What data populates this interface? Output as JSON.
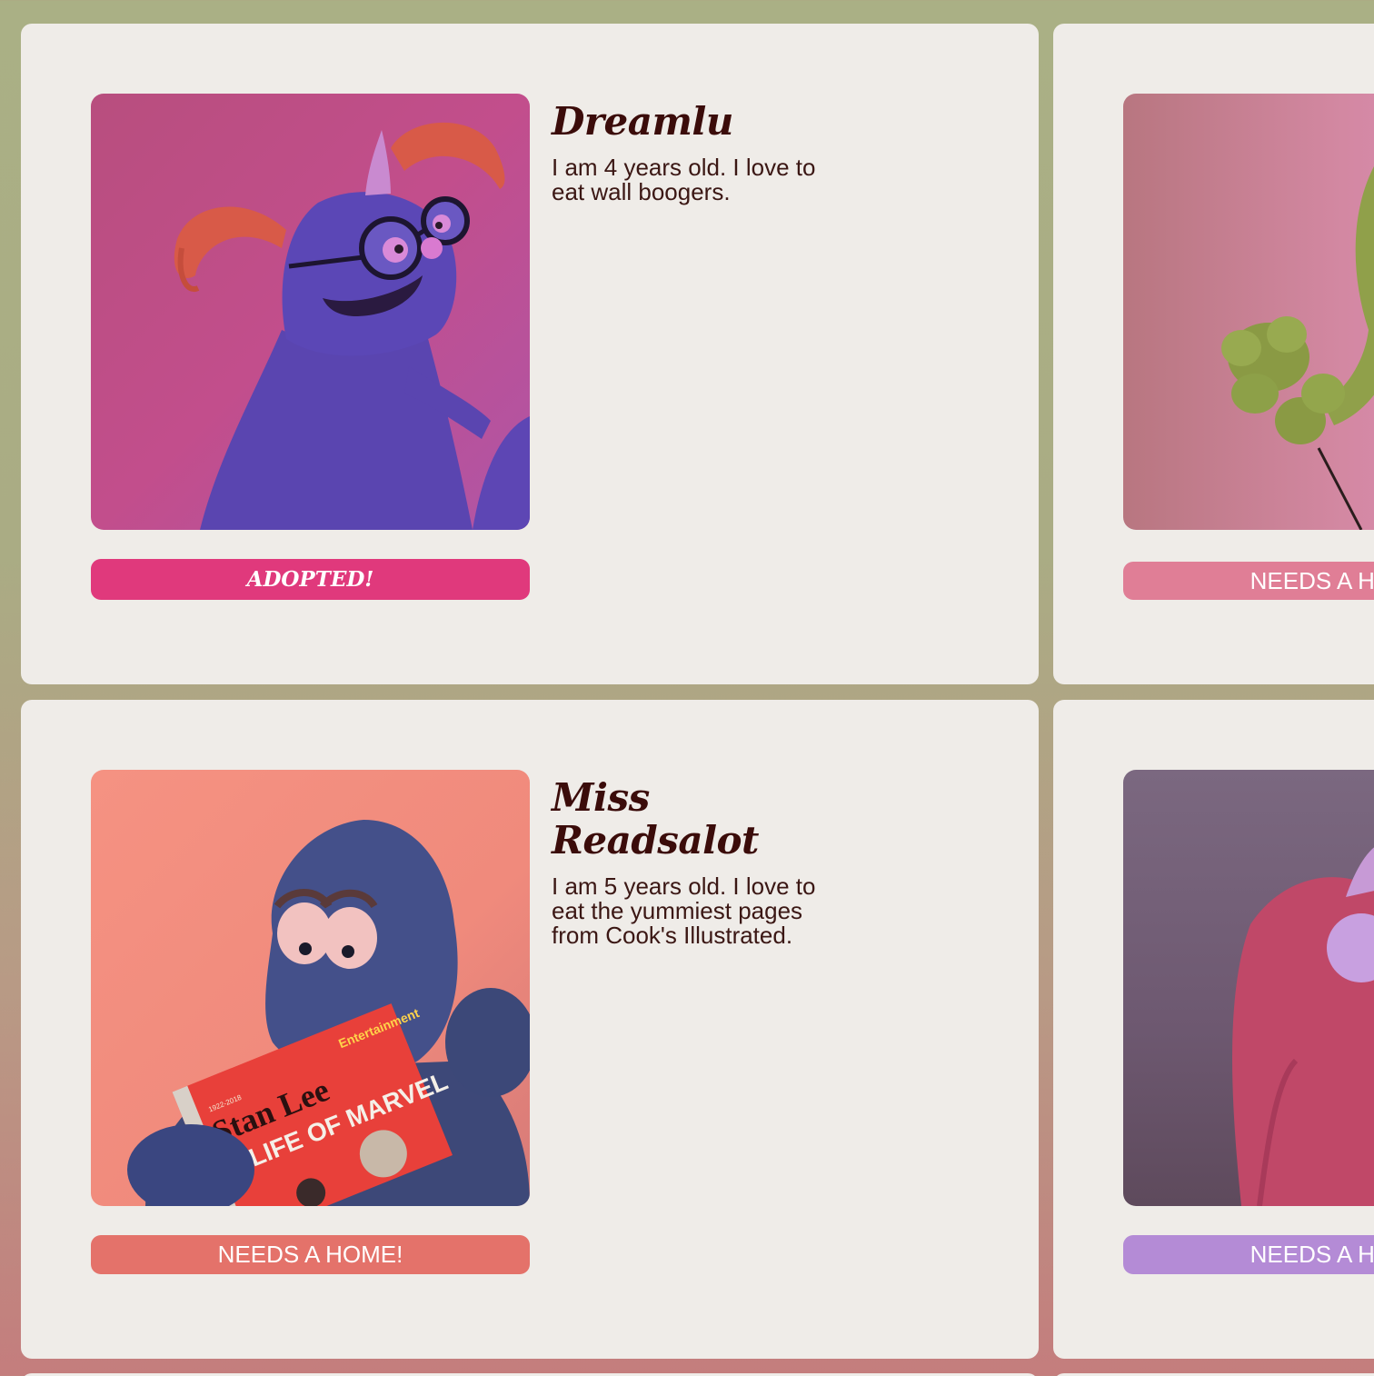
{
  "colors": {
    "card_bg": "#efece8",
    "name_text": "#3b0c0a",
    "adopted_badge": "#e0397c",
    "coral_badge": "#e4726a",
    "pink_badge": "#e07e96",
    "lilac_badge": "#b48bd6"
  },
  "puppets": [
    {
      "name": "Dreamlu",
      "description": "I am 4 years old. I love to eat wall boogers.",
      "status": "ADOPTED!",
      "photo_subject": "blue furry monster with glasses and orange pigtails"
    },
    {
      "name": "",
      "description": "",
      "status": "NEEDS A HOME!",
      "photo_subject": "green furry monster hand with stick"
    },
    {
      "name": "Miss Readsalot",
      "description": "I am 5 years old. I love to eat the yummiest pages from Cook's Illustrated.",
      "status": "NEEDS A HOME!",
      "photo_subject": "blue furry monster reading a magazine",
      "magazine": {
        "masthead": "Entertainment",
        "headline_1": "Stan Lee",
        "headline_2": "A LIFE OF MARVEL",
        "dates": "1922-2018"
      }
    },
    {
      "name": "",
      "description": "",
      "status": "NEEDS A HOME!",
      "photo_subject": "pink furry monster with lavender eye"
    }
  ]
}
